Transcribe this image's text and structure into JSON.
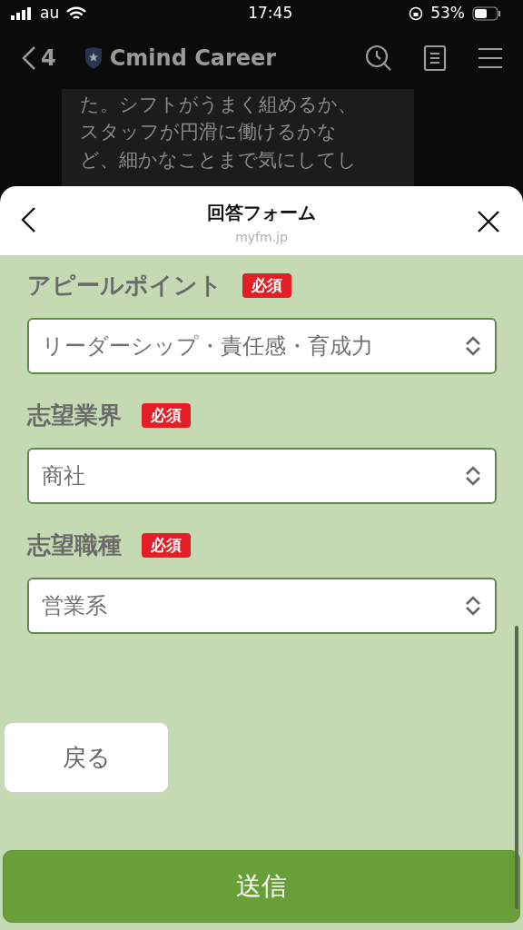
{
  "status_bar": {
    "carrier": "au",
    "time": "17:45",
    "battery": "53%"
  },
  "chat_header": {
    "back_count": "4",
    "title": "Cmind Career"
  },
  "chat_message": {
    "lines": [
      "た。シフトがうまく組めるか、",
      "スタッフが円滑に働けるかな",
      "ど、細かなことまで気にしてし"
    ]
  },
  "sheet": {
    "title": "回答フォーム",
    "domain": "myfm.jp"
  },
  "fields": [
    {
      "label": "アピールポイント",
      "badge": "必須",
      "value": "リーダーシップ・責任感・育成力"
    },
    {
      "label": "志望業界",
      "badge": "必須",
      "value": "商社"
    },
    {
      "label": "志望職種",
      "badge": "必須",
      "value": "営業系"
    }
  ],
  "buttons": {
    "back": "戻る",
    "submit": "送信"
  }
}
